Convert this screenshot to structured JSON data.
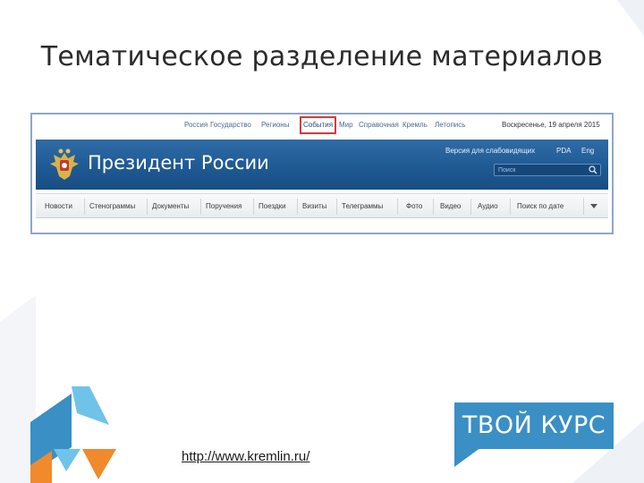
{
  "slide": {
    "title": "Тематическое разделение материалов",
    "url": "http://www.kremlin.ru/"
  },
  "top_nav": {
    "items": [
      "Россия",
      "Государство",
      "Регионы",
      "События",
      "Мир",
      "Справочная",
      "Кремль",
      "Летопись"
    ],
    "active": "События",
    "date": "Воскресенье, 19 апреля 2015"
  },
  "banner": {
    "site_title": "Президент России",
    "links": [
      "Версия для слабовидящих",
      "PDA",
      "Eng"
    ],
    "search_placeholder": "Поиск"
  },
  "sub_nav": {
    "items": [
      "Новости",
      "Стенограммы",
      "Документы",
      "Поручения",
      "Поездки",
      "Визиты",
      "Телеграммы",
      "Фото",
      "Видео",
      "Аудио",
      "Поиск по дате"
    ]
  },
  "brand": {
    "logo_text": "ТВОЙ КУРС"
  },
  "colors": {
    "banner_blue": "#1f5a93",
    "highlight_red": "#d33b3b",
    "brand_blue": "#3a8fc4",
    "accent_orange": "#f08a2c",
    "accent_light_blue": "#6fc3e8"
  },
  "icons": {
    "emblem": "double-headed-eagle-emblem-icon",
    "search": "search-icon",
    "more": "chevron-down-icon"
  }
}
